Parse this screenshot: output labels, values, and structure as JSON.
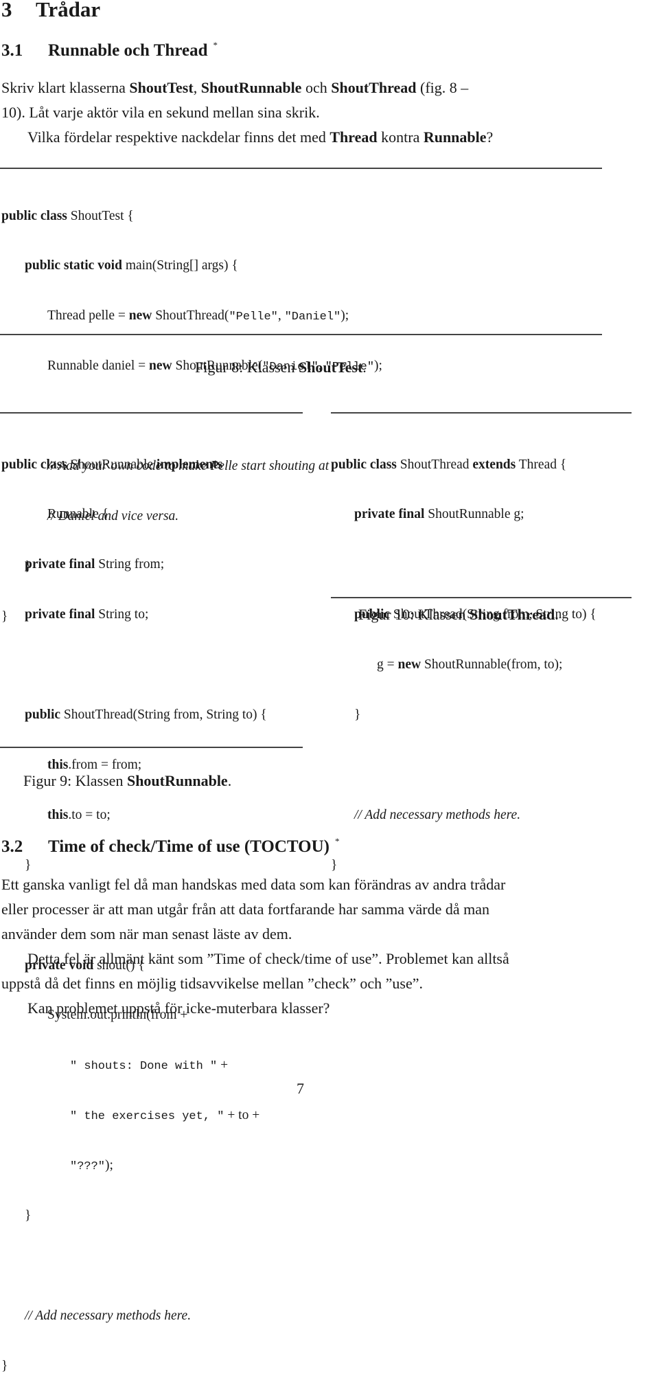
{
  "section": {
    "number": "3",
    "title": "Trådar"
  },
  "subsection1": {
    "number": "3.1",
    "title": "Runnable och Thread",
    "marker": "*",
    "paragraphs": [
      {
        "line1_parts": [
          "Skriv klart klasserna ",
          "ShoutTest",
          ", ",
          "ShoutRunnable",
          " och ",
          "ShoutThread",
          " (fig. 8 –"
        ],
        "line2": "10). Låt varje aktör vila en sekund mellan sina skrik."
      },
      {
        "parts": [
          "Vilka fördelar respektive nackdelar finns det med ",
          "Thread",
          " kontra ",
          "Runnable",
          "?"
        ]
      }
    ]
  },
  "figures": {
    "fig8": {
      "caption_prefix": "Figur 8: Klassen ",
      "caption_bold": "ShoutTest",
      "caption_suffix": ".",
      "code": {
        "l1": [
          "public class",
          " ShoutTest {"
        ],
        "l2": [
          "public static void",
          " main(String[] args) {"
        ],
        "l3": [
          "Thread pelle = ",
          "new",
          " ShoutThread(",
          "\"Pelle\"",
          ", ",
          "\"Daniel\"",
          ");"
        ],
        "l4": [
          "Runnable daniel = ",
          "new",
          " ShoutRunnable(",
          "\"Daniel\"",
          ", ",
          "\"Pelle\"",
          ");"
        ],
        "l5": "// Add your own code to make Pelle start shouting at",
        "l6": "// Daniel and vice versa.",
        "l7": "}",
        "l8": "}"
      }
    },
    "fig9": {
      "caption_prefix": "Figur 9: Klassen ",
      "caption_bold": "ShoutRunnable",
      "caption_suffix": ".",
      "code": {
        "l1": [
          "public class",
          " ShoutRunnable ",
          "implements"
        ],
        "l2": "Runnable {",
        "l3": [
          "private final",
          " String from;"
        ],
        "l4": [
          "private final",
          " String to;"
        ],
        "l5": [
          "public",
          " ShoutThread(String from, String to) {"
        ],
        "l6": [
          "this",
          ".from = from;"
        ],
        "l7": [
          "this",
          ".to = to;"
        ],
        "l8": "}",
        "l9": [
          "private void",
          " shout() {"
        ],
        "l10": "System.out.println(from +",
        "l11": [
          "\" shouts: Done with \"",
          " +"
        ],
        "l12": [
          "\" the exercises yet, \"",
          " + to +"
        ],
        "l13": [
          "\"???\"",
          ");"
        ],
        "l14": "}",
        "l15": "// Add necessary methods here.",
        "l16": "}"
      }
    },
    "fig10": {
      "caption_prefix": "Figur 10: Klassen ",
      "caption_bold": "ShoutThread",
      "caption_suffix": ".",
      "code": {
        "l1": [
          "public class",
          " ShoutThread ",
          "extends",
          " Thread {"
        ],
        "l2": [
          "private final",
          " ShoutRunnable g;"
        ],
        "l3": [
          "public",
          " ShoutThread(String from, String to) {"
        ],
        "l4": [
          "g = ",
          "new",
          " ShoutRunnable(from, to);"
        ],
        "l5": "}",
        "l6": "// Add necessary methods here.",
        "l7": "}"
      }
    }
  },
  "subsection2": {
    "number": "3.2",
    "title": "Time of check/Time of use (TOCTOU)",
    "marker": "*",
    "lines": [
      "Ett ganska vanligt fel då man handskas med data som kan förändras av andra trådar",
      "eller processer är att man utgår från att data fortfarande har samma värde då man",
      "använder dem som när man senast läste av dem.",
      "Detta fel är allmänt känt som ”Time of check/time of use”. Problemet kan alltså",
      "uppstå då det finns en möjlig tidsavvikelse mellan ”check” och ”use”.",
      "Kan problemet uppstå för icke-muterbara klasser?"
    ]
  },
  "page_number": "7"
}
